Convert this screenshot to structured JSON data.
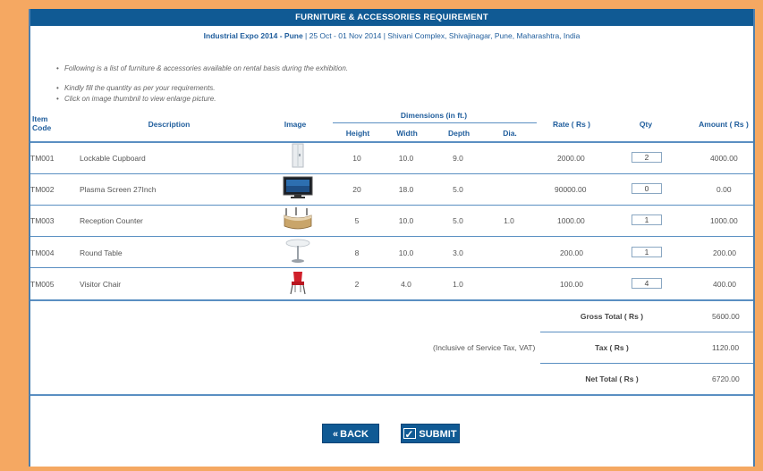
{
  "page": {
    "title": "FURNITURE & ACCESSORIES REQUIREMENT",
    "event_name": "Industrial Expo 2014 - Pune",
    "event_details": " | 25 Oct - 01 Nov 2014 | Shivani Complex, Shivajinagar, Pune, Maharashtra, India"
  },
  "notes": [
    "Following is a list of furniture & accessories available on rental basis during the exhibition.",
    "Kindly fill the quantity as per your requirements.",
    "Click on image thumbnil to view enlarge picture."
  ],
  "headers": {
    "item_code": "Item Code",
    "item_code_l1": "Item",
    "item_code_l2": "Code",
    "description": "Description",
    "image": "Image",
    "dimensions": "Dimensions (in ft.)",
    "height": "Height",
    "width": "Width",
    "depth": "Depth",
    "dia": "Dia.",
    "rate": "Rate ( Rs )",
    "qty": "Qty",
    "amount": "Amount ( Rs )"
  },
  "items": [
    {
      "code": "TM001",
      "description": "Lockable Cupboard",
      "image": "cupboard-thumbnail",
      "height": "10",
      "width": "10.0",
      "depth": "9.0",
      "dia": "",
      "rate": "2000.00",
      "qty": "2",
      "amount": "4000.00"
    },
    {
      "code": "TM002",
      "description": "Plasma Screen 27Inch",
      "image": "plasma-screen-thumbnail",
      "height": "20",
      "width": "18.0",
      "depth": "5.0",
      "dia": "",
      "rate": "90000.00",
      "qty": "0",
      "amount": "0.00"
    },
    {
      "code": "TM003",
      "description": "Reception Counter",
      "image": "reception-counter-thumbnail",
      "height": "5",
      "width": "10.0",
      "depth": "5.0",
      "dia": "1.0",
      "rate": "1000.00",
      "qty": "1",
      "amount": "1000.00"
    },
    {
      "code": "TM004",
      "description": "Round Table",
      "image": "round-table-thumbnail",
      "height": "8",
      "width": "10.0",
      "depth": "3.0",
      "dia": "",
      "rate": "200.00",
      "qty": "1",
      "amount": "200.00"
    },
    {
      "code": "TM005",
      "description": "Visitor Chair",
      "image": "visitor-chair-thumbnail",
      "height": "2",
      "width": "4.0",
      "depth": "1.0",
      "dia": "",
      "rate": "100.00",
      "qty": "4",
      "amount": "400.00"
    }
  ],
  "totals": {
    "gross_label": "Gross Total ( Rs )",
    "gross_value": "5600.00",
    "tax_note": "(Inclusive of Service Tax, VAT)",
    "tax_label": "Tax ( Rs )",
    "tax_value": "1120.00",
    "net_label": "Net Total ( Rs )",
    "net_value": "6720.00"
  },
  "buttons": {
    "back": "BACK",
    "submit": "SUBMIT"
  },
  "colors": {
    "page_background": "#f5a862",
    "header_bar": "#105a94",
    "accent_text": "#1f5d9c"
  }
}
